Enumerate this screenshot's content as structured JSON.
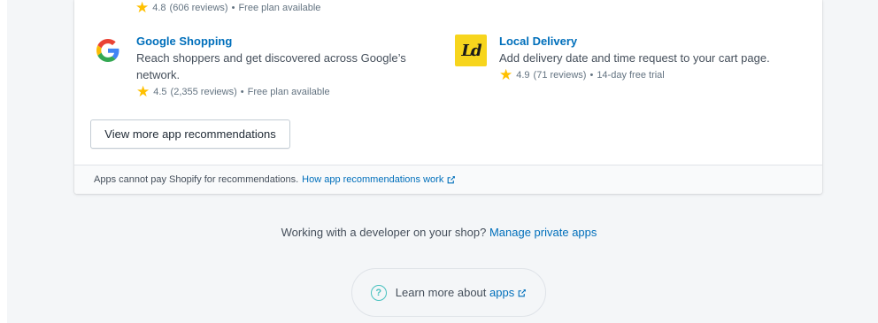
{
  "top_partial": {
    "rating": "4.8",
    "reviews": "(606 reviews)",
    "sep": "•",
    "pricing": "Free plan available"
  },
  "apps": [
    {
      "name": "Google Shopping",
      "description": "Reach shoppers and get discovered across Google’s network.",
      "rating": "4.5",
      "reviews": "(2,355 reviews)",
      "sep": "•",
      "pricing": "Free plan available",
      "icon": "google-g-logo"
    },
    {
      "name": "Local Delivery",
      "description": "Add delivery date and time request to your cart page.",
      "rating": "4.9",
      "reviews": "(71 reviews)",
      "sep": "•",
      "pricing": "14-day free trial",
      "icon": "local-delivery-logo",
      "icon_text": "Ld"
    }
  ],
  "view_more_label": "View more app recommendations",
  "footer": {
    "text": "Apps cannot pay Shopify for recommendations.",
    "link": "How app recommendations work"
  },
  "developer": {
    "text": "Working with a developer on your shop?",
    "link": "Manage private apps"
  },
  "learn_more": {
    "text": "Learn more about",
    "link": "apps"
  },
  "colors": {
    "link": "#006fbb",
    "star": "#ffc000",
    "page_bg": "#f4f6f8",
    "help_icon": "#47c1bf",
    "local_delivery_icon_bg": "#f7d51d"
  }
}
